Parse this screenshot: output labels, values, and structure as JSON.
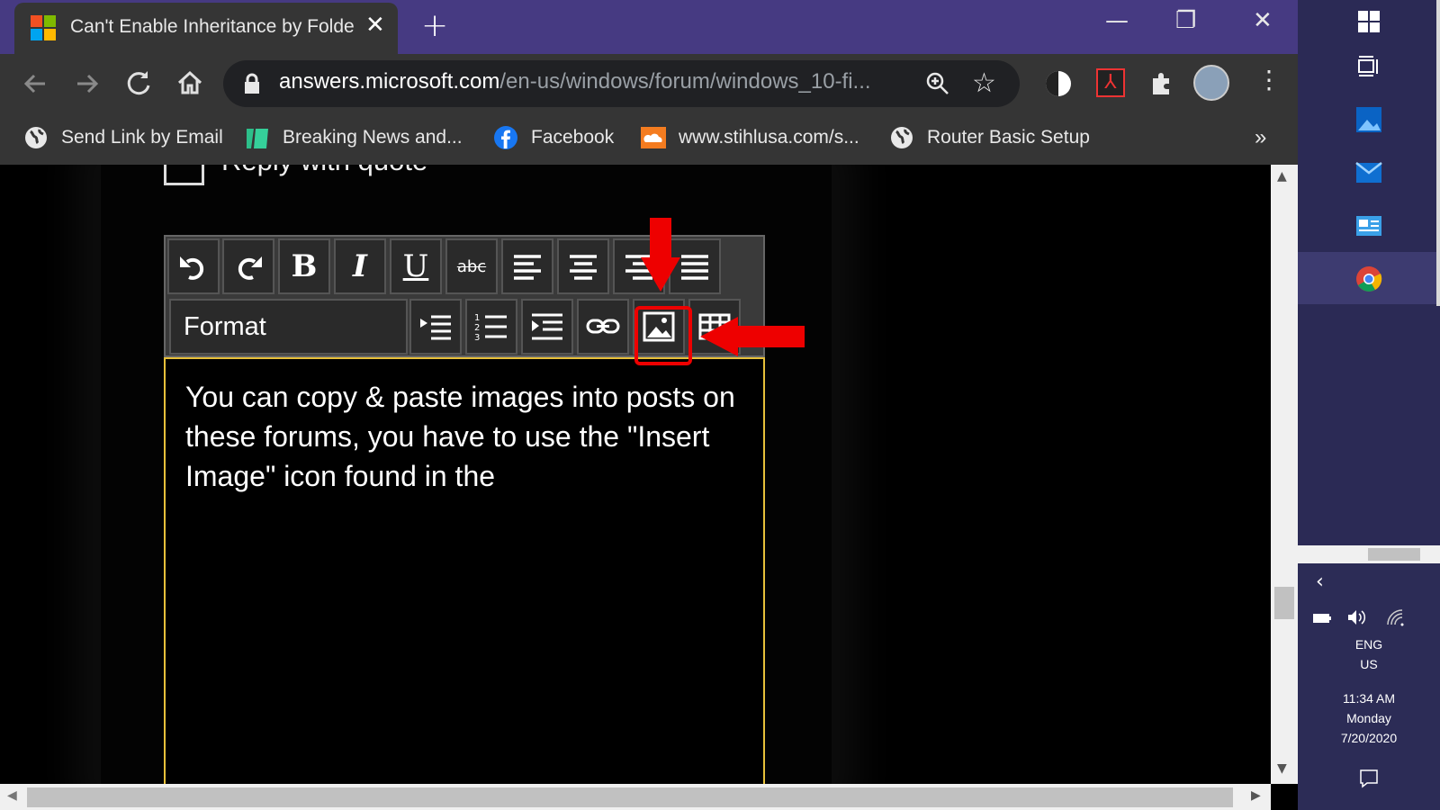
{
  "colors": {
    "titlebar": "#463a82",
    "chrome": "#353535",
    "accent_red": "#e00000",
    "editor_border": "#e7c03a"
  },
  "tab": {
    "title": "Can't Enable Inheritance by Folde",
    "close": "✕",
    "new_tab": "+"
  },
  "window": {
    "minimize": "—",
    "restore": "❐",
    "close": "✕"
  },
  "address": {
    "host": "answers.microsoft.com",
    "path": "/en-us/windows/forum/windows_10-fi..."
  },
  "bookmarks": [
    {
      "label": "Send Link by Email",
      "icon": "globe-icon"
    },
    {
      "label": "Breaking News and...",
      "icon": "news-icon"
    },
    {
      "label": "Facebook",
      "icon": "facebook-icon"
    },
    {
      "label": "www.stihlusa.com/s...",
      "icon": "cloud-icon"
    },
    {
      "label": "Router Basic Setup",
      "icon": "globe-icon"
    }
  ],
  "bookmarks_overflow": "»",
  "reply": {
    "label": "Reply with quote"
  },
  "editor": {
    "format_label": "Format",
    "buttons_row1": [
      "undo",
      "redo",
      "bold",
      "italic",
      "underline",
      "strikethrough",
      "align-left",
      "align-center",
      "align-right",
      "justify"
    ],
    "buttons_row2": [
      "bullet-list",
      "numbered-list",
      "indent",
      "link",
      "insert-image",
      "table"
    ],
    "bold": "B",
    "italic": "I",
    "underline": "U",
    "strike": "abc",
    "text": "You can copy & paste images into posts on these forums, you have to use the \"Insert Image\" icon found in the"
  },
  "tray": {
    "lang1": "ENG",
    "lang2": "US",
    "time": "11:34 AM",
    "day": "Monday",
    "date": "7/20/2020"
  }
}
